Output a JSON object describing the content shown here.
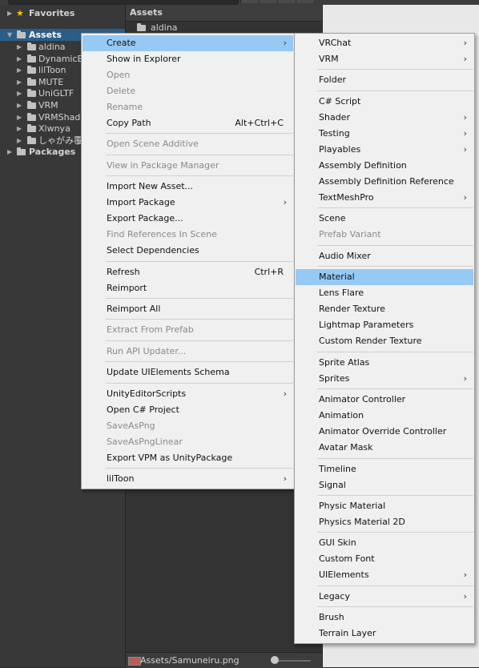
{
  "tree": {
    "favorites": "Favorites",
    "assets": "Assets",
    "children": [
      "aldina",
      "DynamicB",
      "lilToon",
      "MUTE",
      "UniGLTF",
      "VRM",
      "VRMShade",
      "Xlwnya",
      "しゃがみ覆き"
    ],
    "packages": "Packages"
  },
  "assets_panel": {
    "header": "Assets",
    "folder": "aldina",
    "status_path": "Assets/Samuneiru.png"
  },
  "main_menu": {
    "items": [
      {
        "label": "Create",
        "submenu": true,
        "highlighted": true
      },
      {
        "label": "Show in Explorer"
      },
      {
        "label": "Open",
        "disabled": true
      },
      {
        "label": "Delete",
        "disabled": true
      },
      {
        "label": "Rename",
        "disabled": true
      },
      {
        "label": "Copy Path",
        "shortcut": "Alt+Ctrl+C"
      },
      {
        "label": "Open Scene Additive",
        "disabled": true
      },
      {
        "label": "View in Package Manager",
        "disabled": true
      },
      {
        "label": "Import New Asset..."
      },
      {
        "label": "Import Package",
        "submenu": true
      },
      {
        "label": "Export Package..."
      },
      {
        "label": "Find References In Scene",
        "disabled": true
      },
      {
        "label": "Select Dependencies"
      },
      {
        "label": "Refresh",
        "shortcut": "Ctrl+R"
      },
      {
        "label": "Reimport"
      },
      {
        "label": "Reimport All"
      },
      {
        "label": "Extract From Prefab",
        "disabled": true
      },
      {
        "label": "Run API Updater...",
        "disabled": true
      },
      {
        "label": "Update UIElements Schema"
      },
      {
        "label": "UnityEditorScripts",
        "submenu": true
      },
      {
        "label": "Open C# Project"
      },
      {
        "label": "SaveAsPng",
        "disabled": true
      },
      {
        "label": "SaveAsPngLinear",
        "disabled": true
      },
      {
        "label": "Export VPM as UnityPackage"
      },
      {
        "label": "lilToon",
        "submenu": true
      }
    ]
  },
  "create_menu": {
    "items": [
      {
        "label": "VRChat",
        "submenu": true
      },
      {
        "label": "VRM",
        "submenu": true
      },
      {
        "label": "Folder"
      },
      {
        "label": "C# Script"
      },
      {
        "label": "Shader",
        "submenu": true
      },
      {
        "label": "Testing",
        "submenu": true
      },
      {
        "label": "Playables",
        "submenu": true
      },
      {
        "label": "Assembly Definition"
      },
      {
        "label": "Assembly Definition Reference"
      },
      {
        "label": "TextMeshPro",
        "submenu": true
      },
      {
        "label": "Scene"
      },
      {
        "label": "Prefab Variant",
        "disabled": true
      },
      {
        "label": "Audio Mixer"
      },
      {
        "label": "Material",
        "highlighted": true
      },
      {
        "label": "Lens Flare"
      },
      {
        "label": "Render Texture"
      },
      {
        "label": "Lightmap Parameters"
      },
      {
        "label": "Custom Render Texture"
      },
      {
        "label": "Sprite Atlas"
      },
      {
        "label": "Sprites",
        "submenu": true
      },
      {
        "label": "Animator Controller"
      },
      {
        "label": "Animation"
      },
      {
        "label": "Animator Override Controller"
      },
      {
        "label": "Avatar Mask"
      },
      {
        "label": "Timeline"
      },
      {
        "label": "Signal"
      },
      {
        "label": "Physic Material"
      },
      {
        "label": "Physics Material 2D"
      },
      {
        "label": "GUI Skin"
      },
      {
        "label": "Custom Font"
      },
      {
        "label": "UIElements",
        "submenu": true
      },
      {
        "label": "Legacy",
        "submenu": true
      },
      {
        "label": "Brush"
      },
      {
        "label": "Terrain Layer"
      }
    ]
  },
  "icons": {
    "submenu": "submenu-arrow-icon",
    "expand": "tree-expand-arrow-icon",
    "folder": "folder-icon",
    "favorite": "star-icon"
  },
  "colors": {
    "highlight": "#97c9f5",
    "selection": "#2c5d87",
    "menu_bg": "#f0f0f0",
    "disabled_text": "#8a8a8a"
  }
}
